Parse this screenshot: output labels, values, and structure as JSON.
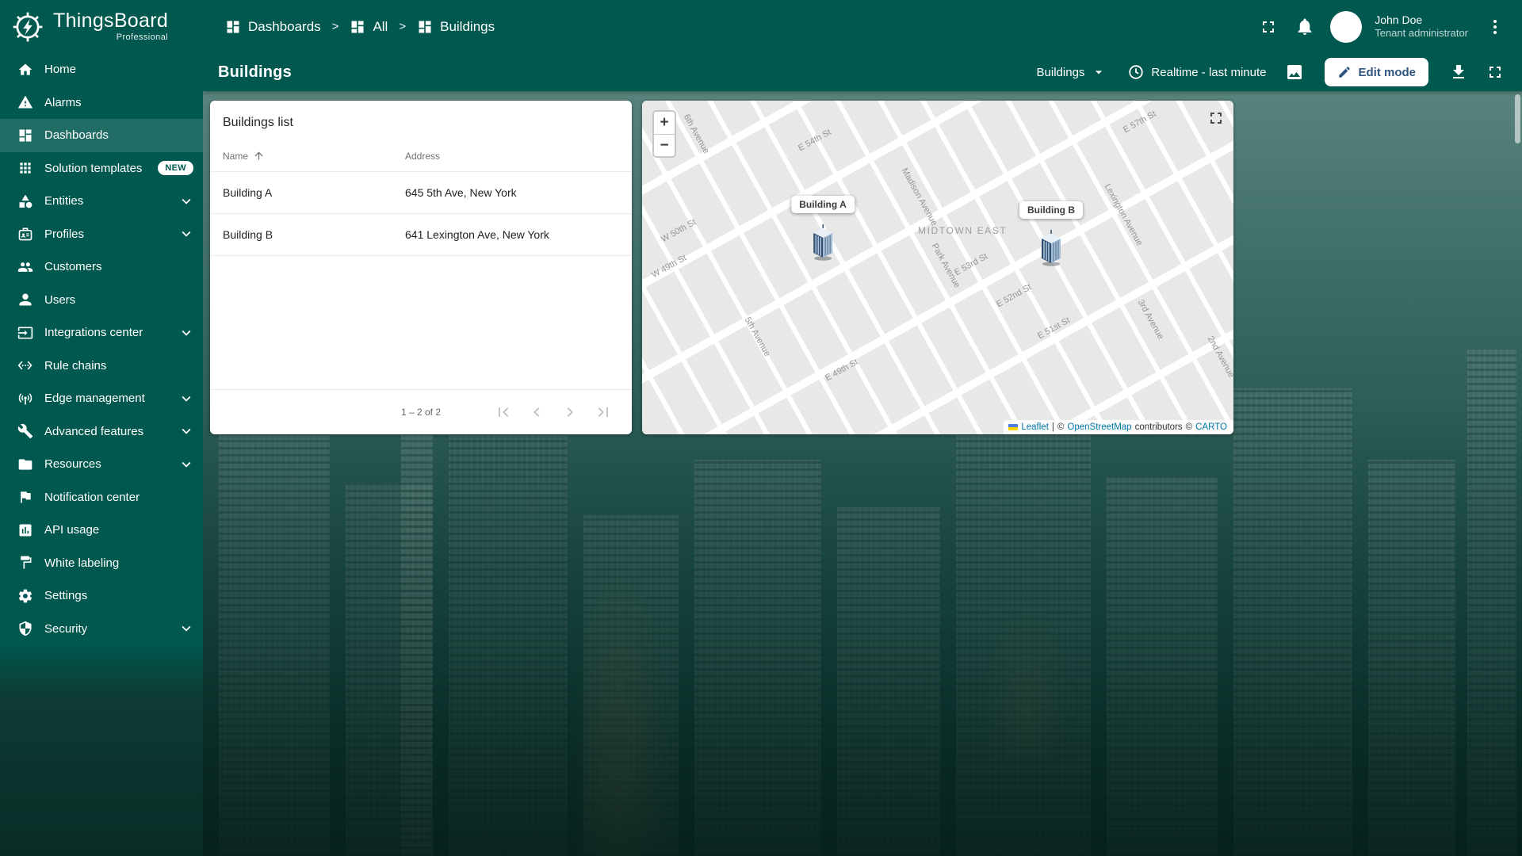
{
  "colors": {
    "sidebar_teal": "#00584F",
    "active_menu_overlay": "#17695E",
    "edit_button_text": "#305680",
    "link_blue": "#0078A8",
    "marker_building_blue": "#2F4D70"
  },
  "app": {
    "brand": "ThingsBoard",
    "brand_sub": "Professional"
  },
  "sidebar": {
    "items": [
      {
        "label": "Home"
      },
      {
        "label": "Alarms"
      },
      {
        "label": "Dashboards",
        "active": true
      },
      {
        "label": "Solution templates",
        "badge": "NEW"
      },
      {
        "label": "Entities",
        "expandable": true
      },
      {
        "label": "Profiles",
        "expandable": true
      },
      {
        "label": "Customers"
      },
      {
        "label": "Users"
      },
      {
        "label": "Integrations center",
        "expandable": true
      },
      {
        "label": "Rule chains"
      },
      {
        "label": "Edge management",
        "expandable": true
      },
      {
        "label": "Advanced features",
        "expandable": true
      },
      {
        "label": "Resources",
        "expandable": true
      },
      {
        "label": "Notification center"
      },
      {
        "label": "API usage"
      },
      {
        "label": "White labeling"
      },
      {
        "label": "Settings"
      },
      {
        "label": "Security",
        "expandable": true
      }
    ]
  },
  "header": {
    "breadcrumb": [
      {
        "label": "Dashboards"
      },
      {
        "label": "All"
      },
      {
        "label": "Buildings"
      }
    ],
    "breadcrumb_sep": ">",
    "user": {
      "name": "John Doe",
      "role": "Tenant administrator"
    }
  },
  "toolbar": {
    "title": "Buildings",
    "entity_select": "Buildings",
    "timewindow": "Realtime - last minute",
    "edit_button": "Edit mode"
  },
  "list_card": {
    "title": "Buildings list",
    "columns": {
      "name": "Name",
      "address": "Address"
    },
    "rows": [
      {
        "name": "Building A",
        "address": "645 5th Ave, New York"
      },
      {
        "name": "Building B",
        "address": "641 Lexington Ave, New York"
      }
    ],
    "pagination": "1 – 2 of 2"
  },
  "map": {
    "zoom_in": "+",
    "zoom_out": "−",
    "area_label": "MIDTOWN EAST",
    "markers": [
      {
        "label": "Building A"
      },
      {
        "label": "Building B"
      }
    ],
    "streets": [
      "6th Avenue",
      "E 54th St",
      "E 57th St",
      "Lexington Avenue",
      "Madison Avenue",
      "W 50th St",
      "W 49th St",
      "E 53rd St",
      "E 52nd St",
      "E 51st St",
      "Park Avenue",
      "5th Avenue",
      "E 49th St",
      "3rd Avenue",
      "2nd Avenue"
    ],
    "attribution": {
      "leaflet": "Leaflet",
      "sep": "|",
      "osm_prefix": "©",
      "osm": "OpenStreetMap",
      "contributors": "contributors",
      "carto_prefix": "©",
      "carto": "CARTO"
    }
  }
}
